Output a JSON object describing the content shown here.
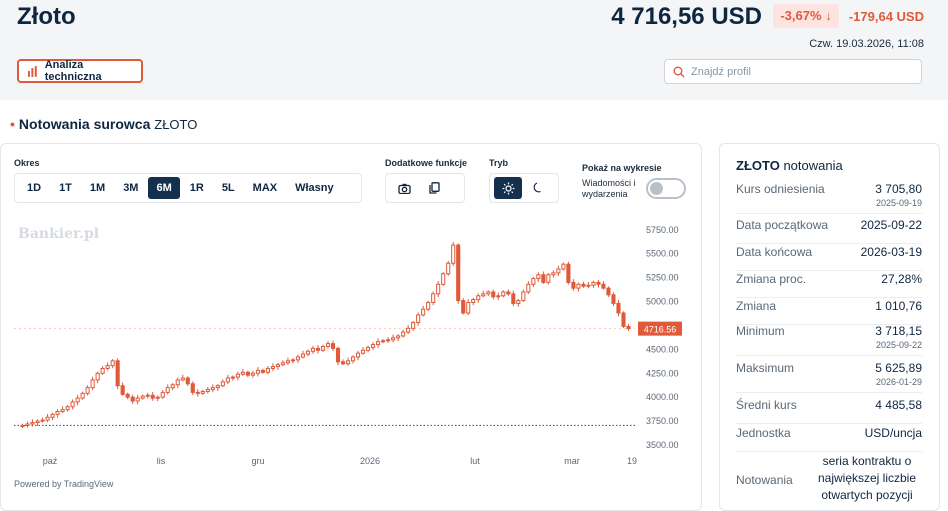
{
  "header": {
    "title": "Złoto",
    "price": "4 716,56 USD",
    "change_pct": "-3,67% ↓",
    "change_abs": "-179,64 USD",
    "timestamp": "Czw. 19.03.2026, 11:08",
    "analiza_label": "Analiza techniczna",
    "search_placeholder": "Znajdź profil"
  },
  "section": {
    "title": "Notowania surowca",
    "subtitle": "ZŁOTO"
  },
  "controls": {
    "okres_label": "Okres",
    "periods": [
      "1D",
      "1T",
      "1M",
      "3M",
      "6M",
      "1R",
      "5L",
      "MAX",
      "Własny"
    ],
    "active_period": "6M",
    "dodatkowe_label": "Dodatkowe funkcje",
    "tryb_label": "Tryb",
    "pokaz_label": "Pokaż na wykresie",
    "toggle_label": "Wiadomości i wydarzenia",
    "icons": [
      "camera-icon",
      "copy-icon",
      "sun-icon",
      "moon-icon"
    ]
  },
  "chart_data": {
    "type": "candlestick",
    "watermark": "Bankier.pl",
    "x_ticks": [
      "paź",
      "lis",
      "gru",
      "2026",
      "lut",
      "mar",
      "19"
    ],
    "y_ticks": [
      3500,
      3750,
      4000,
      4250,
      4500,
      4750,
      5000,
      5250,
      5500,
      5750
    ],
    "ylim": [
      3500,
      5800
    ],
    "last_price_label": "4716.56",
    "last_price": 4716.56,
    "reference_line": 3705.8,
    "up_color": "#ffffff",
    "down_color": "#e05a3a",
    "close_series": [
      3705,
      3720,
      3735,
      3750,
      3760,
      3790,
      3820,
      3850,
      3870,
      3900,
      3950,
      3990,
      4040,
      4100,
      4180,
      4250,
      4300,
      4330,
      4380,
      4120,
      4030,
      4000,
      3960,
      3990,
      4010,
      4020,
      3990,
      4000,
      4050,
      4100,
      4130,
      4180,
      4200,
      4140,
      4050,
      4040,
      4060,
      4080,
      4100,
      4120,
      4160,
      4200,
      4210,
      4240,
      4260,
      4230,
      4250,
      4280,
      4260,
      4300,
      4320,
      4340,
      4360,
      4380,
      4390,
      4420,
      4450,
      4480,
      4510,
      4490,
      4530,
      4560,
      4510,
      4370,
      4350,
      4380,
      4420,
      4460,
      4490,
      4520,
      4550,
      4580,
      4590,
      4600,
      4620,
      4640,
      4680,
      4720,
      4780,
      4860,
      4920,
      4990,
      5080,
      5180,
      5290,
      5400,
      5590,
      5010,
      4880,
      4990,
      5020,
      5060,
      5080,
      5100,
      5050,
      5060,
      5100,
      5080,
      4980,
      5010,
      5100,
      5180,
      5240,
      5280,
      5200,
      5280,
      5300,
      5340,
      5390,
      5200,
      5140,
      5180,
      5160,
      5170,
      5200,
      5180,
      5140,
      5070,
      4980,
      4880,
      4740,
      4716.56
    ],
    "title": "",
    "xlabel": "",
    "ylabel": ""
  },
  "footer": {
    "powered": "Powered by TradingView"
  },
  "stats": {
    "title_bold": "ZŁOTO",
    "title_rest": "notowania",
    "rows": [
      {
        "label": "Kurs odniesienia",
        "value": "3 705,80",
        "date": "2025-09-19"
      },
      {
        "label": "Data początkowa",
        "value": "2025-09-22"
      },
      {
        "label": "Data końcowa",
        "value": "2026-03-19"
      },
      {
        "label": "Zmiana proc.",
        "value": "27,28%"
      },
      {
        "label": "Zmiana",
        "value": "1 010,76"
      },
      {
        "label": "Minimum",
        "value": "3 718,15",
        "date": "2025-09-22"
      },
      {
        "label": "Maksimum",
        "value": "5 625,89",
        "date": "2026-01-29"
      },
      {
        "label": "Średni kurs",
        "value": "4 485,58"
      },
      {
        "label": "Jednostka",
        "value": "USD/uncja"
      },
      {
        "label": "Notowania",
        "value_lines": [
          "seria kontraktu o",
          "największej liczbie",
          "otwartych pozycji"
        ]
      }
    ]
  }
}
